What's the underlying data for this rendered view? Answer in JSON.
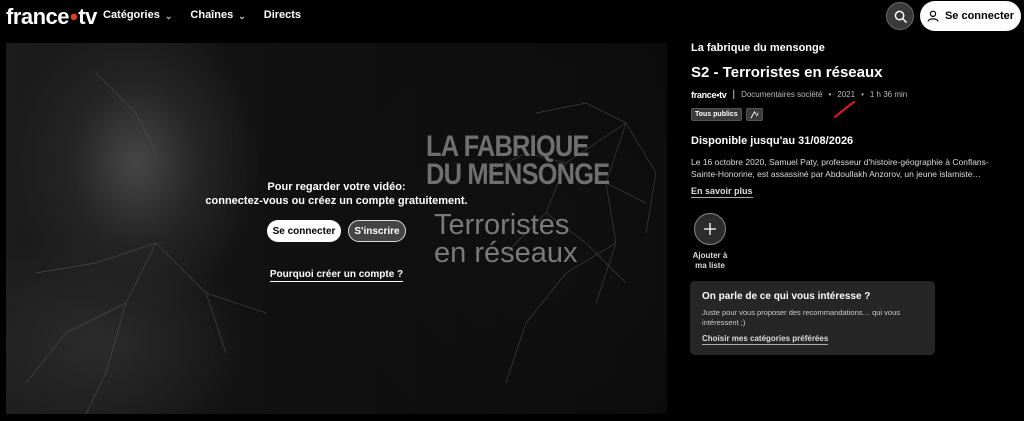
{
  "header": {
    "logo_text": "france",
    "logo_dot": "•",
    "logo_suffix": "tv",
    "nav": [
      {
        "label": "Catégories",
        "has_chevron": true
      },
      {
        "label": "Chaînes",
        "has_chevron": true
      },
      {
        "label": "Directs",
        "has_chevron": false
      }
    ],
    "search_icon": "search-icon",
    "connect_label": "Se connecter",
    "connect_icon": "user-icon"
  },
  "player": {
    "bg_title_line1": "LA FABRIQUE",
    "bg_title_line2": "DU MENSONGE",
    "bg_subtitle_line1": "Terroristes",
    "bg_subtitle_line2": "en réseaux",
    "message_line1": "Pour regarder votre vidéo:",
    "message_line2": "connectez-vous ou créez un compte gratuitement.",
    "login_label": "Se connecter",
    "signup_label": "S'inscrire",
    "why_link": "Pourquoi créer un compte ?"
  },
  "info": {
    "show_title": "La fabrique du mensonge",
    "episode_title": "S2 - Terroristes en réseaux",
    "channel_logo": "france•tv",
    "genre": "Documentaires société",
    "year": "2021",
    "duration": "1 h 36 min",
    "badge_audience": "Tous publics",
    "badge_icon": "audio-description-icon",
    "availability": "Disponible jusqu'au 31/08/2026",
    "description": "Le 16 octobre 2020, Samuel Paty, professeur d'histoire-géographie à Conflans-Sainte-Honorine, est assassiné par Abdoullakh Anzorov, un jeune islamiste…",
    "more_link": "En savoir plus",
    "add_icon": "plus-icon",
    "add_label_line1": "Ajouter à",
    "add_label_line2": "ma liste",
    "annotation_color": "#e01919"
  },
  "reco": {
    "title": "On parle de ce qui vous intéresse ?",
    "text": "Juste pour vous proposer des recommandations… qui vous intéressent ;)",
    "link": "Choisir mes catégories préférées"
  },
  "colors": {
    "accent": "#e0411a",
    "background": "#000000",
    "card": "#262626"
  }
}
